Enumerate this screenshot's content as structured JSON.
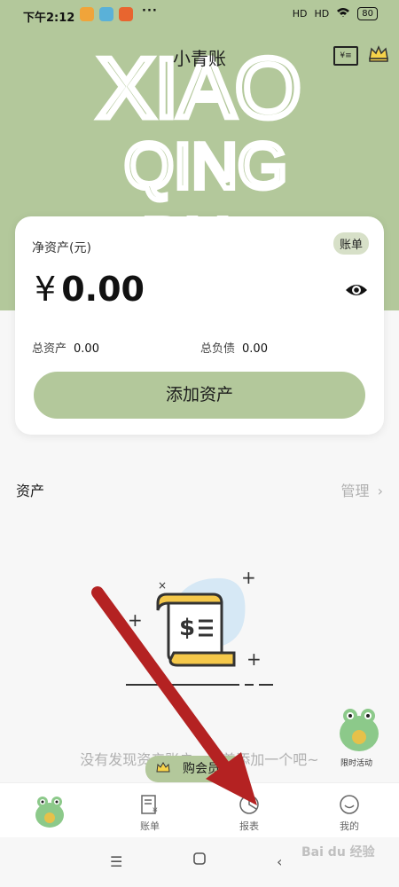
{
  "status_bar": {
    "time": "下午2:12",
    "dots": "···",
    "signal1": "HD",
    "signal2": "HD",
    "battery": "80"
  },
  "header": {
    "title": "小青账",
    "bg_letters": [
      "XIAO",
      "QING",
      "BU"
    ],
    "accent_color": "#b3c89b"
  },
  "card": {
    "net_assets_label": "净资产(元)",
    "bill_badge": "账单",
    "currency": "¥",
    "amount": "0.00",
    "total_assets_label": "总资产",
    "total_assets_value": "0.00",
    "total_debts_label": "总负债",
    "total_debts_value": "0.00",
    "add_button": "添加资产"
  },
  "assets_section": {
    "title": "资产",
    "manage": "管理"
  },
  "empty_state": {
    "text": "没有发现资产账户，试着添加一个吧~"
  },
  "vip_pill": {
    "label": "购会员"
  },
  "promo": {
    "label": "限时活动"
  },
  "tabs": [
    {
      "label": "",
      "icon": "frog-avatar-icon"
    },
    {
      "label": "账单",
      "icon": "bill-icon"
    },
    {
      "label": "报表",
      "icon": "report-icon"
    },
    {
      "label": "我的",
      "icon": "profile-icon"
    }
  ],
  "watermark": "Bai du 经验"
}
